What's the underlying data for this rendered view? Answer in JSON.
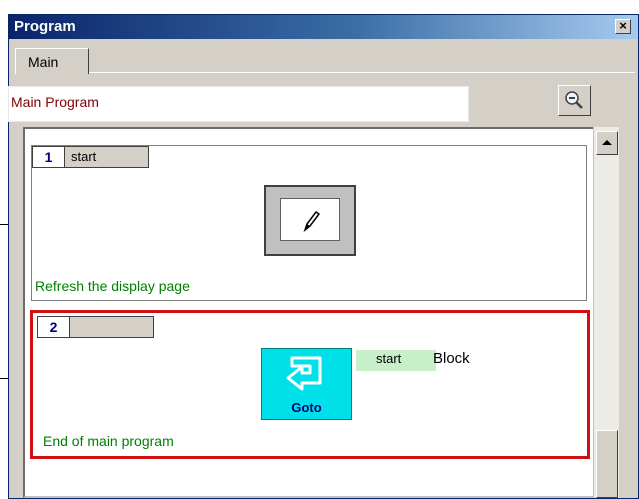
{
  "window": {
    "title": "Program",
    "close_icon": "close-icon"
  },
  "tabs": [
    {
      "label": "Main",
      "active": true
    }
  ],
  "header": {
    "title": "Main Program",
    "zoom_icon": "zoom-out-icon"
  },
  "blocks": [
    {
      "number": "1",
      "label": "start",
      "icon": "pencil-icon",
      "comment": "Refresh the display page",
      "selected": false
    },
    {
      "number": "2",
      "label": "",
      "icon": "goto-icon",
      "icon_caption": "Goto",
      "target_label": "start",
      "target_type": "Block",
      "comment": "End of main program",
      "selected": true
    }
  ],
  "colors": {
    "title_bar": "#0a246a",
    "header_text": "#800000",
    "comment_text": "#008000",
    "selection_border": "#d01010",
    "goto_fill": "#00e0e8"
  }
}
